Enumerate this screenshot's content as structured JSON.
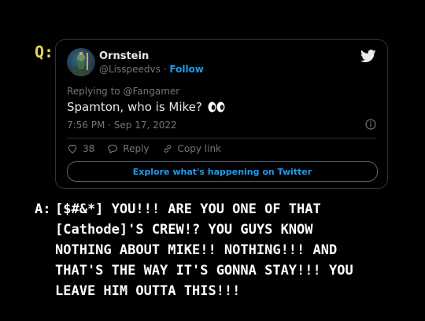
{
  "q_label": "Q:",
  "tweet": {
    "name": "Ornstein",
    "handle": "@Lisspeedvs",
    "separator": "·",
    "follow": "Follow",
    "replying_to": "Replying to @Fangamer",
    "text": "Spamton, who is Mike?",
    "timestamp": "7:56 PM · Sep 17, 2022",
    "likes": "38",
    "reply_label": "Reply",
    "copy_link_label": "Copy link",
    "explore_label": "Explore what's happening on Twitter"
  },
  "answer": {
    "label": "A:",
    "lines": [
      "[$#&*] YOU!!! ARE YOU ONE OF THAT",
      "[Cathode]'S CREW!? YOU GUYS KNOW",
      "NOTHING ABOUT MIKE!! NOTHING!!! AND",
      "THAT'S THE WAY IT'S GONNA STAY!!! YOU",
      "LEAVE HIM OUTTA THIS!!!"
    ]
  },
  "colors": {
    "q_label": "#e8d35a",
    "link": "#1d9bf0",
    "muted": "#71767b",
    "background": "#000000"
  },
  "icons": [
    "twitter-bird-icon",
    "eyes-emoji-icon",
    "info-icon",
    "heart-icon",
    "reply-bubble-icon",
    "link-icon"
  ]
}
